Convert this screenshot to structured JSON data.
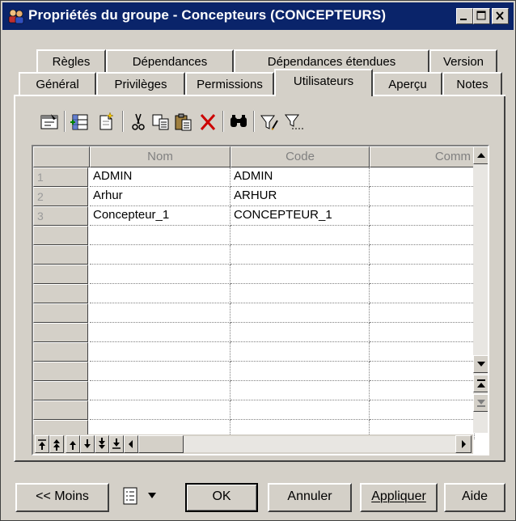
{
  "window": {
    "title": "Propriétés du groupe - Concepteurs (CONCEPTEURS)",
    "controls": [
      "minimize",
      "maximize",
      "close"
    ]
  },
  "tabs": {
    "row_back": [
      "Règles",
      "Dépendances",
      "Dépendances étendues",
      "Version"
    ],
    "row_front": [
      "Général",
      "Privilèges",
      "Permissions",
      "Utilisateurs",
      "Aperçu",
      "Notes"
    ],
    "active": "Utilisateurs"
  },
  "toolbar": {
    "icons": [
      "properties-icon",
      "add-rows-icon",
      "insert-row-icon",
      "cut-icon",
      "copy-icon",
      "paste-icon",
      "delete-icon",
      "find-icon",
      "filter-icon",
      "customize-columns-icon"
    ]
  },
  "grid": {
    "columns": [
      "Nom",
      "Code",
      "Comm"
    ],
    "rows": [
      {
        "num": "1",
        "nom": "ADMIN",
        "code": "ADMIN",
        "comment": ""
      },
      {
        "num": "2",
        "nom": "Arhur",
        "code": "ARHUR",
        "comment": ""
      },
      {
        "num": "3",
        "nom": "Concepteur_1",
        "code": "CONCEPTEUR_1",
        "comment": ""
      }
    ],
    "empty_rows": 11
  },
  "buttons": {
    "less": "<< Moins",
    "ok": "OK",
    "cancel": "Annuler",
    "apply": "Appliquer",
    "help": "Aide"
  },
  "colors": {
    "titlebar": "#0a246a",
    "face": "#d4d0c8",
    "delete_icon": "#cc0000"
  }
}
